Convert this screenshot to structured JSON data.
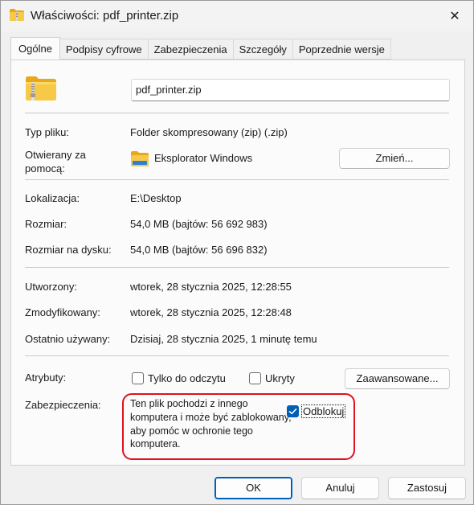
{
  "window": {
    "title": "Właściwości: pdf_printer.zip",
    "close_glyph": "✕"
  },
  "tabs": [
    {
      "label": "Ogólne",
      "active": true
    },
    {
      "label": "Podpisy cyfrowe",
      "active": false
    },
    {
      "label": "Zabezpieczenia",
      "active": false
    },
    {
      "label": "Szczegóły",
      "active": false
    },
    {
      "label": "Poprzednie wersje",
      "active": false
    }
  ],
  "general": {
    "file_name": "pdf_printer.zip",
    "type_label": "Typ pliku:",
    "type_value": "Folder skompresowany (zip) (.zip)",
    "opens_with_label_line1": "Otwierany za",
    "opens_with_label_line2": "pomocą:",
    "opens_with_value": "Eksplorator Windows",
    "change_button": "Zmień...",
    "location_label": "Lokalizacja:",
    "location_value": "E:\\Desktop",
    "size_label": "Rozmiar:",
    "size_value": "54,0 MB (bajtów: 56 692 983)",
    "size_on_disk_label": "Rozmiar na dysku:",
    "size_on_disk_value": "54,0 MB (bajtów: 56 696 832)",
    "created_label": "Utworzony:",
    "created_value": "wtorek, 28 stycznia 2025, 12:28:55",
    "modified_label": "Zmodyfikowany:",
    "modified_value": "wtorek, 28 stycznia 2025, 12:28:48",
    "accessed_label": "Ostatnio używany:",
    "accessed_value": "Dzisiaj, 28 stycznia 2025, 1 minutę temu",
    "attributes_label": "Atrybuty:",
    "readonly_label": "Tylko do odczytu",
    "readonly_checked": false,
    "hidden_label": "Ukryty",
    "hidden_checked": false,
    "advanced_button": "Zaawansowane...",
    "security_label": "Zabezpieczenia:",
    "security_text_line1": "Ten plik pochodzi z innego",
    "security_text_line2": "komputera i może być zablokowany,",
    "security_text_line3": "aby pomóc w ochronie tego",
    "security_text_line4": "komputera.",
    "unblock_label": "Odblokuj",
    "unblock_checked": true
  },
  "footer": {
    "ok": "OK",
    "cancel": "Anuluj",
    "apply": "Zastosuj"
  },
  "colors": {
    "accent": "#005fb8",
    "highlight_border": "#e0101f",
    "folder_yellow": "#f4c542"
  },
  "icons": {
    "title": "zip-folder-icon",
    "file": "zip-folder-icon",
    "opens_with": "file-explorer-icon"
  }
}
